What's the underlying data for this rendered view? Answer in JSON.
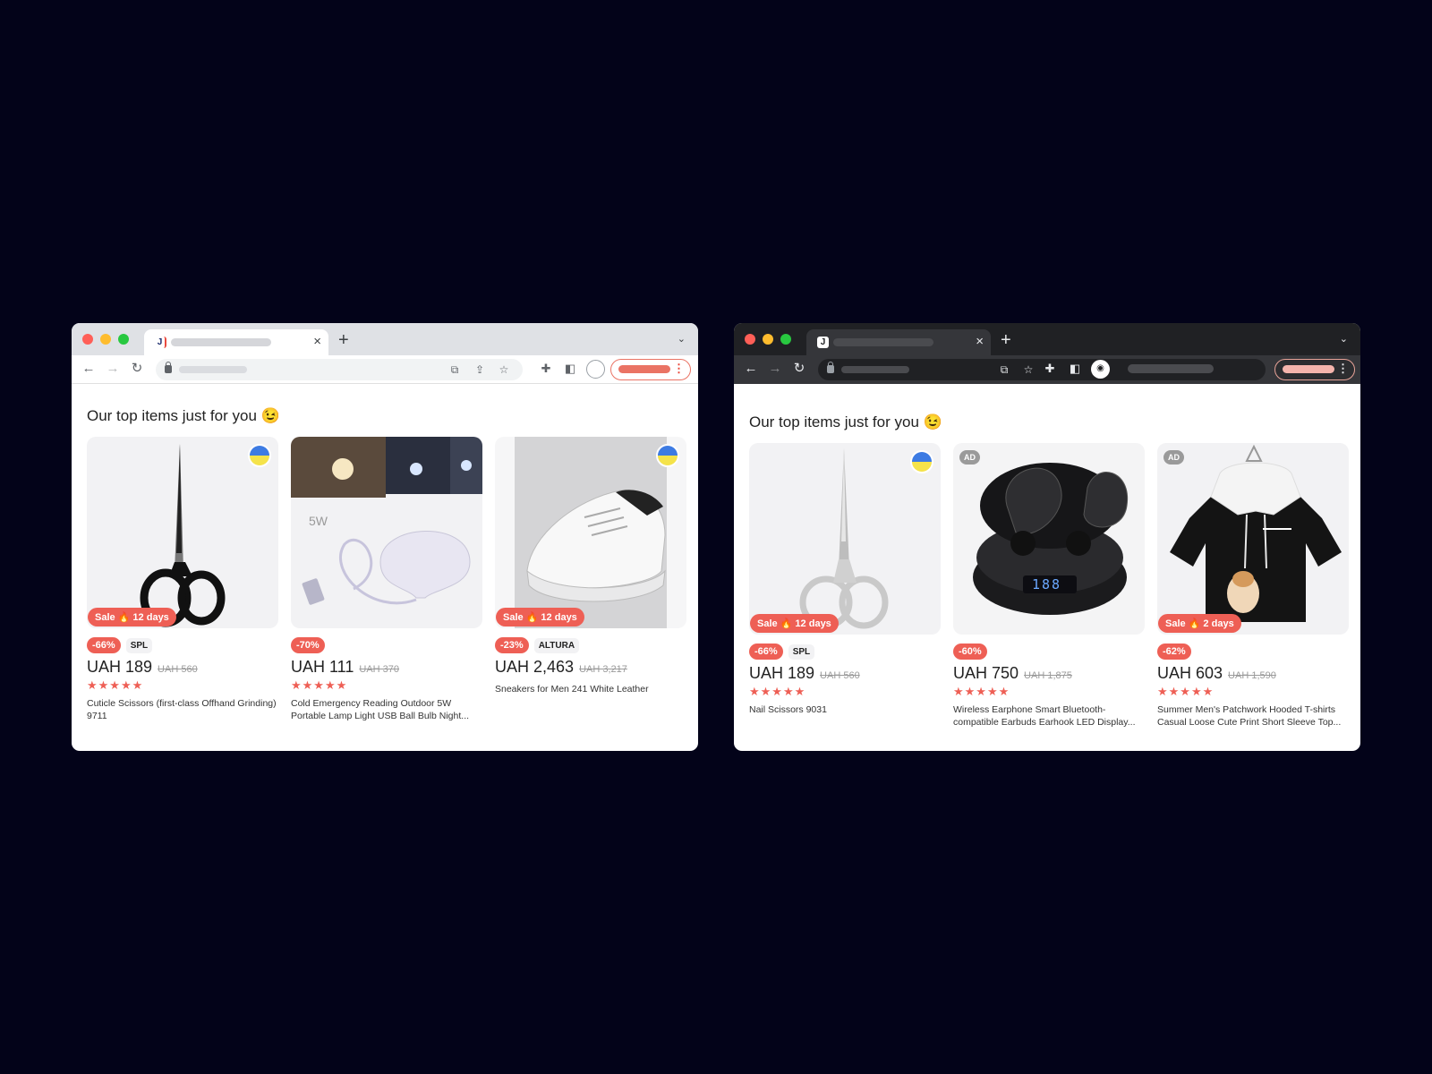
{
  "windows": [
    {
      "theme": "light",
      "tab": {
        "favicon": "J",
        "close": "×"
      },
      "new_tab": "+",
      "section_title": "Our top items just for you 😉",
      "products": [
        {
          "sale_label": "Sale 🔥 12 days",
          "discount": "-66%",
          "brand": "SPL",
          "price": "UAH 189",
          "old_price": "UAH 560",
          "rating": 5,
          "stars": "★★★★★",
          "name": "Cuticle Scissors (first-class Offhand Grinding) 9711",
          "flag": true,
          "ad": false,
          "image": "black-scissors"
        },
        {
          "sale_label": "",
          "discount": "-70%",
          "brand": "",
          "price": "UAH 111",
          "old_price": "UAH 370",
          "rating": 4.5,
          "stars": "★★★★★",
          "name": "Cold Emergency Reading Outdoor 5W Portable Lamp Light USB Ball Bulb Night...",
          "image_text": "5W",
          "flag": false,
          "ad": false,
          "image": "usb-bulb"
        },
        {
          "sale_label": "Sale 🔥 12 days",
          "discount": "-23%",
          "brand": "ALTURA",
          "price": "UAH 2,463",
          "old_price": "UAH 3,217",
          "rating": 0,
          "stars": "",
          "name": "Sneakers for Men 241 White Leather",
          "flag": true,
          "ad": false,
          "image": "white-sneaker"
        }
      ]
    },
    {
      "theme": "dark",
      "tab": {
        "favicon": "J",
        "close": "×"
      },
      "new_tab": "+",
      "section_title": "Our top items just for you 😉",
      "products": [
        {
          "sale_label": "Sale 🔥 12 days",
          "discount": "-66%",
          "brand": "SPL",
          "price": "UAH 189",
          "old_price": "UAH 560",
          "rating": 4.5,
          "stars": "★★★★★",
          "name": "Nail Scissors 9031",
          "flag": true,
          "ad": false,
          "image": "silver-scissors"
        },
        {
          "sale_label": "",
          "discount": "-60%",
          "brand": "",
          "price": "UAH 750",
          "old_price": "UAH 1,875",
          "rating": 4.5,
          "stars": "★★★★★",
          "name": "Wireless Earphone Smart Bluetooth-compatible Earbuds Earhook LED Display...",
          "flag": false,
          "ad": true,
          "ad_label": "AD",
          "image": "earbuds",
          "image_text": "188"
        },
        {
          "sale_label": "Sale 🔥 2 days",
          "discount": "-62%",
          "brand": "",
          "price": "UAH 603",
          "old_price": "UAH 1,590",
          "rating": 5,
          "stars": "★★★★★",
          "name": "Summer Men's Patchwork Hooded T-shirts Casual Loose Cute Print Short Sleeve Top...",
          "flag": false,
          "ad": true,
          "ad_label": "AD",
          "image": "hooded-tshirt"
        }
      ]
    }
  ],
  "icons": {
    "back": "←",
    "forward": "→",
    "reload": "↻",
    "translate": "⧉",
    "share": "⇪",
    "bookmark": "☆",
    "extensions": "✚",
    "sidepanel": "◧",
    "menu": "⋮",
    "chevron": "⌄",
    "incognito": "◉"
  },
  "colors": {
    "accent": "#ee5f55",
    "background": "#030319"
  }
}
